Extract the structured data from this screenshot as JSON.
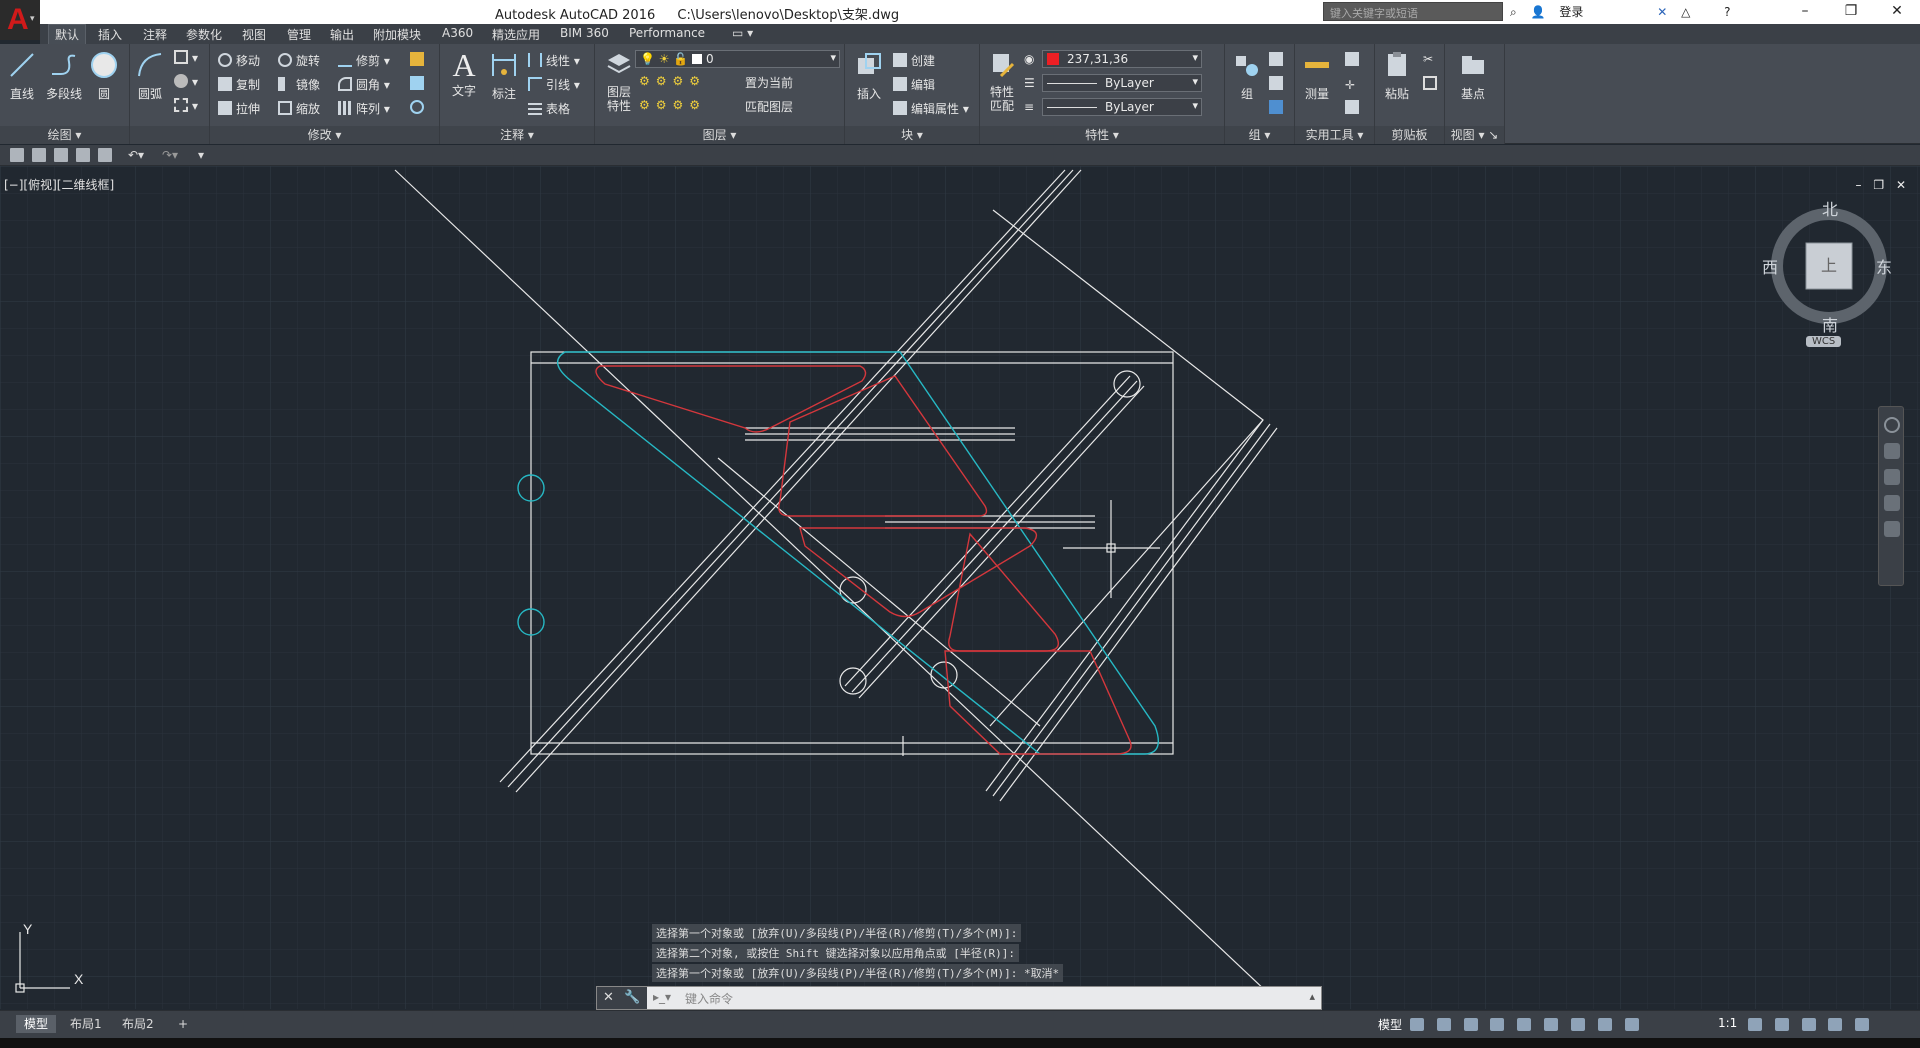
{
  "titlebar": {
    "app_name": "Autodesk AutoCAD 2016",
    "file_path": "C:\\Users\\lenovo\\Desktop\\支架.dwg",
    "search_placeholder": "键入关键字或短语",
    "login": "登录"
  },
  "tabs": [
    "默认",
    "插入",
    "注释",
    "参数化",
    "视图",
    "管理",
    "输出",
    "附加模块",
    "A360",
    "精选应用",
    "BIM 360",
    "Performance"
  ],
  "ribbon": {
    "draw": {
      "title": "绘图",
      "line": "直线",
      "polyline": "多段线",
      "circle": "圆",
      "arc": "圆弧"
    },
    "modify": {
      "title": "修改",
      "move": "移动",
      "rotate": "旋转",
      "trim": "修剪",
      "copy": "复制",
      "mirror": "镜像",
      "fillet": "圆角",
      "stretch": "拉伸",
      "scale": "缩放",
      "array": "阵列"
    },
    "annotation": {
      "title": "注释",
      "text": "文字",
      "dimension": "标注",
      "linear": "线性",
      "leader": "引线",
      "table": "表格"
    },
    "layers": {
      "title": "图层",
      "layer_props": "图层\n特性",
      "current_layer": "0",
      "set_current": "置为当前",
      "match_layer": "匹配图层"
    },
    "block": {
      "title": "块",
      "insert": "插入",
      "create": "创建",
      "edit": "编辑",
      "edit_attr": "编辑属性"
    },
    "properties": {
      "title": "特性",
      "match": "特性\n匹配",
      "color": "237,31,36",
      "linetype": "ByLayer",
      "lineweight": "ByLayer",
      "color_hex": "#ed1f24"
    },
    "groups": {
      "title": "组",
      "group": "组"
    },
    "utilities": {
      "title": "实用工具",
      "measure": "测量"
    },
    "clipboard": {
      "title": "剪贴板",
      "paste": "粘贴"
    },
    "view": {
      "title": "视图",
      "base": "基点"
    }
  },
  "viewport": {
    "label": "[−][俯视][二维线框]",
    "viewcube": {
      "north": "北",
      "south": "南",
      "east": "东",
      "west": "西",
      "top": "上",
      "wcs": "WCS"
    },
    "ucs": {
      "x": "X",
      "y": "Y"
    }
  },
  "command": {
    "history": [
      "选择第一个对象或 [放弃(U)/多段线(P)/半径(R)/修剪(T)/多个(M)]:",
      "选择第二个对象, 或按住 Shift 键选择对象以应用角点或 [半径(R)]:",
      "选择第一个对象或 [放弃(U)/多段线(P)/半径(R)/修剪(T)/多个(M)]: *取消*"
    ],
    "placeholder": "键入命令"
  },
  "status": {
    "layouts": [
      "模型",
      "布局1",
      "布局2"
    ],
    "model": "模型",
    "scale": "1:1"
  },
  "colors": {
    "white_lines": "#e8e8e8",
    "cyan": "#26b8c4",
    "red": "#d4373c",
    "background": "#212830"
  }
}
